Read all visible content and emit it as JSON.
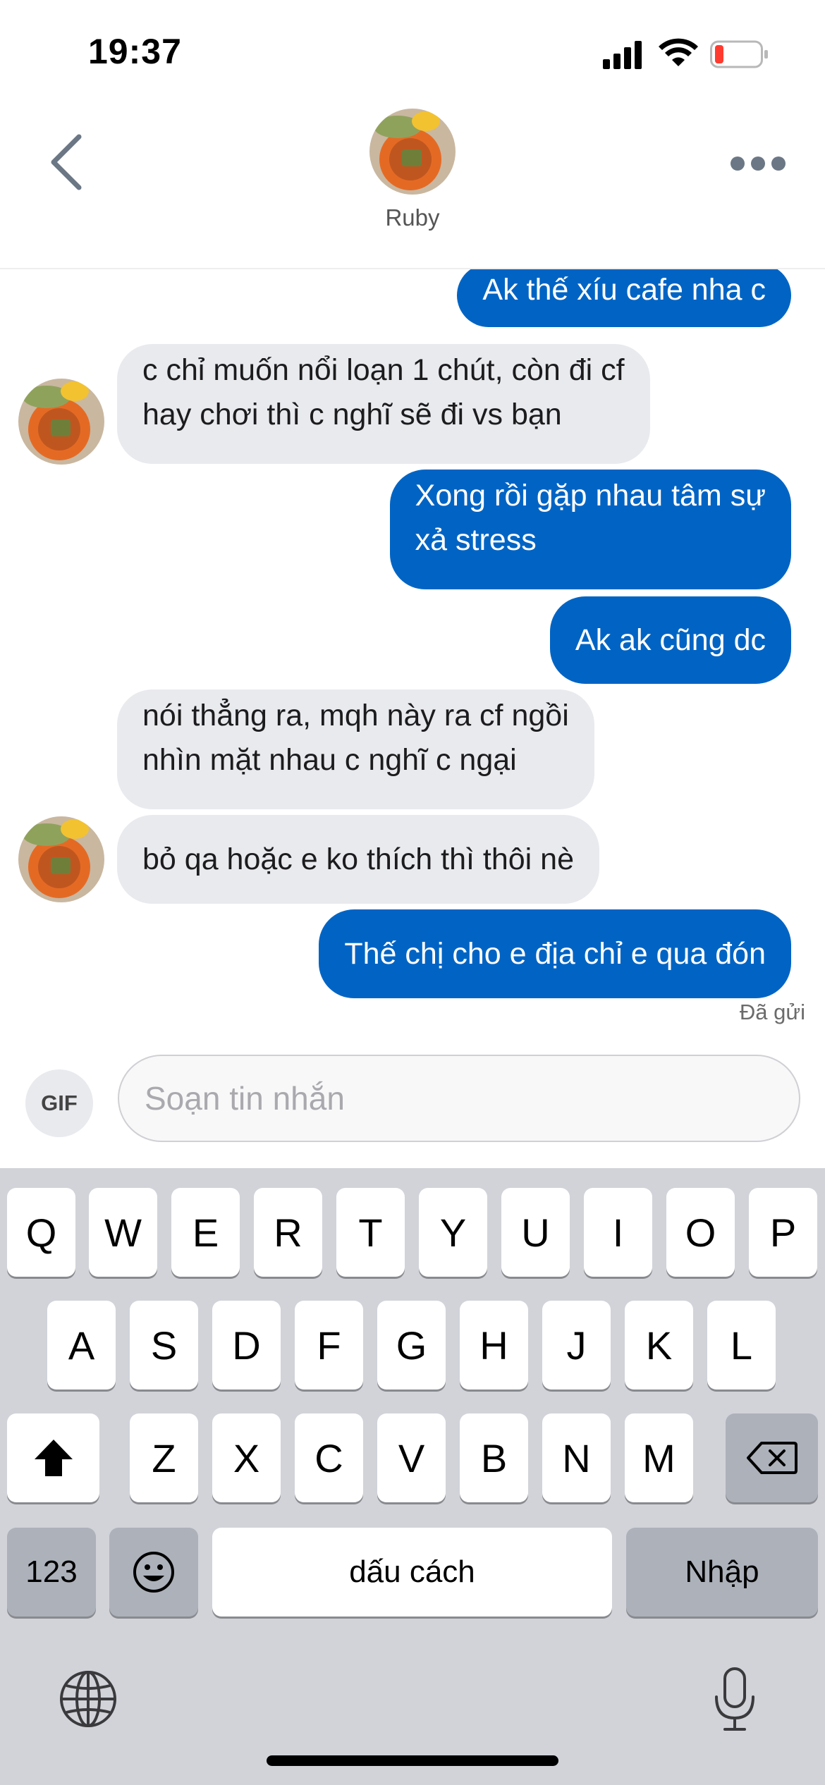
{
  "status_bar": {
    "time": "19:37",
    "icons": [
      "cellular-signal-icon",
      "wifi-icon",
      "battery-low-icon"
    ],
    "battery_color": "#ff3b30"
  },
  "header": {
    "contact_name": "Ruby",
    "icons": [
      "chevron-left-icon",
      "more-horizontal-icon"
    ]
  },
  "messages": [
    {
      "direction": "out",
      "text": "Ak thế xíu cafe nha c"
    },
    {
      "direction": "in",
      "text": "c chỉ muốn nổi loạn 1 chút, còn đi cf\nhay chơi thì c nghĩ sẽ đi vs bạn",
      "avatar": true
    },
    {
      "direction": "out",
      "text": "Xong rồi gặp nhau tâm sự\nxả stress"
    },
    {
      "direction": "out",
      "text": "Ak ak cũng dc"
    },
    {
      "direction": "in",
      "text": "nói thẳng ra, mqh này ra cf ngồi\nnhìn mặt nhau c nghĩ c ngại"
    },
    {
      "direction": "in",
      "text": "bỏ qa hoặc e ko thích thì thôi nè",
      "avatar": true
    },
    {
      "direction": "out",
      "text": "Thế chị cho e địa chỉ e qua đón"
    }
  ],
  "sent_status": "Đã gửi",
  "composer": {
    "gif_label": "GIF",
    "placeholder": "Soạn tin nhắn"
  },
  "keyboard": {
    "row1": [
      "Q",
      "W",
      "E",
      "R",
      "T",
      "Y",
      "U",
      "I",
      "O",
      "P"
    ],
    "row2": [
      "A",
      "S",
      "D",
      "F",
      "G",
      "H",
      "J",
      "K",
      "L"
    ],
    "row3": [
      "Z",
      "X",
      "C",
      "V",
      "B",
      "N",
      "M"
    ],
    "numbers_label": "123",
    "space_label": "dấu cách",
    "return_label": "Nhập",
    "icons": [
      "shift-icon",
      "backspace-icon",
      "emoji-icon",
      "globe-icon",
      "microphone-icon"
    ]
  },
  "colors": {
    "outgoing_bubble": "#0164c4",
    "incoming_bubble": "#e9eaee",
    "keyboard_background": "#d1d3d9"
  }
}
